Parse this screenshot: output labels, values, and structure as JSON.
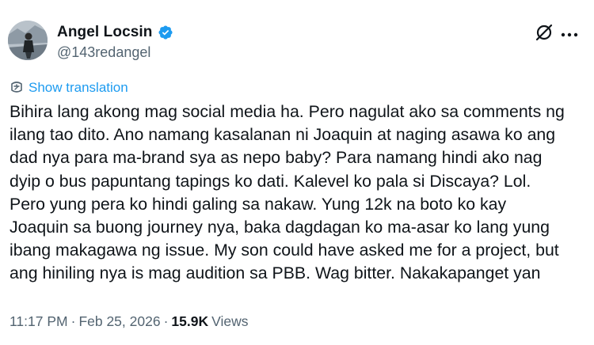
{
  "author": {
    "display_name": "Angel Locsin",
    "handle": "@143redangel",
    "verified": true,
    "verified_color": "#1d9bf0"
  },
  "header_icons": {
    "grok": "grok-icon",
    "more": "more-icon"
  },
  "translation": {
    "label": "Show translation",
    "icon": "translate-icon"
  },
  "tweet": {
    "text": "Bihira lang akong mag social media ha. Pero nagulat ako sa comments ng\nilang tao dito. Ano namang kasalanan ni Joaquin at naging asawa ko ang\ndad nya para ma-brand sya as nepo baby? Para namang hindi ako nag\ndyip o bus papuntang tapings ko dati. Kalevel ko pala si Discaya? Lol.\nPero yung pera ko hindi galing sa nakaw. Yung 12k na boto ko kay\nJoaquin sa buong journey nya, baka dagdagan ko ma-asar ko lang yung\nibang makagawa ng issue. My son could have asked me for a project, but\nang hiniling nya is mag audition sa PBB. Wag bitter. Nakakapanget yan"
  },
  "meta": {
    "time": "11:17 PM",
    "sep1": "·",
    "date": "Feb 25, 2026",
    "sep2": "·",
    "views_count": "15.9K",
    "views_label": "Views"
  },
  "colors": {
    "text": "#0f1419",
    "secondary": "#536471",
    "link": "#1d9bf0"
  }
}
